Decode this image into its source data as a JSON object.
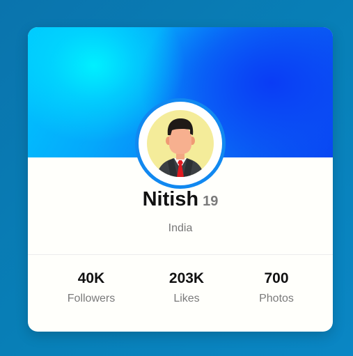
{
  "profile": {
    "name": "Nitish",
    "age": "19",
    "country": "India",
    "avatar_icon": "businessman-avatar-icon"
  },
  "stats": [
    {
      "value": "40K",
      "label": "Followers"
    },
    {
      "value": "203K",
      "label": "Likes"
    },
    {
      "value": "700",
      "label": "Photos"
    }
  ],
  "colors": {
    "page_background": "#0a7fb8",
    "card_background": "#fffffb",
    "banner_cyan": "#00e8ff",
    "banner_blue": "#0a3cf5",
    "avatar_ring": "#1188f0",
    "avatar_background": "#f4ec9a"
  }
}
